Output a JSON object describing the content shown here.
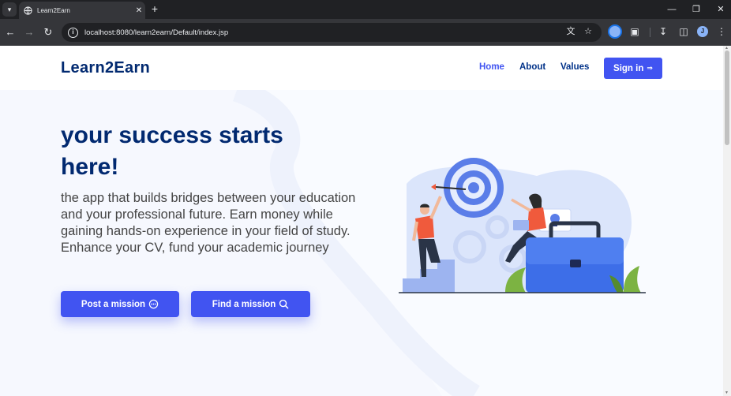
{
  "browser": {
    "tab_title": "Learn2Earn",
    "url": "localhost:8080/learn2earn/Default/index.jsp",
    "profile_initial": "J"
  },
  "site": {
    "logo": "Learn2Earn",
    "nav": {
      "home": "Home",
      "about": "About",
      "values": "Values",
      "signin": "Sign in"
    }
  },
  "hero": {
    "headline": "your success starts here!",
    "lead": "the app that builds bridges between your education and your professional future. Earn money while gaining hands-on experience in your field of study. Enhance your CV, fund your academic journey",
    "post_button": "Post a mission",
    "find_button": "Find a mission"
  },
  "colors": {
    "accent": "#4154f1",
    "navy": "#012970",
    "hero_bg": "#f6f9ff"
  },
  "icons": {
    "post_button": "chat-dots-icon",
    "find_button": "search-icon",
    "signin": "box-arrow-in-right-icon"
  }
}
